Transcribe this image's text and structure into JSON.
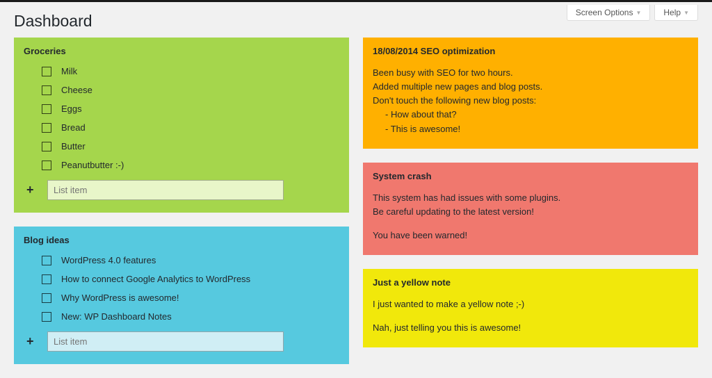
{
  "header": {
    "page_title": "Dashboard",
    "screen_options": "Screen Options",
    "help": "Help"
  },
  "notes": {
    "groceries": {
      "title": "Groceries",
      "items": [
        "Milk",
        "Cheese",
        "Eggs",
        "Bread",
        "Butter",
        "Peanutbutter :-)"
      ],
      "add_placeholder": "List item"
    },
    "blog_ideas": {
      "title": "Blog ideas",
      "items": [
        "WordPress 4.0 features",
        "How to connect Google Analytics to WordPress",
        "Why WordPress is awesome!",
        "New: WP Dashboard Notes"
      ],
      "add_placeholder": "List item"
    },
    "seo": {
      "title": "18/08/2014 SEO optimization",
      "lines": [
        "Been busy with SEO for two hours.",
        "Added multiple new pages and blog posts.",
        "Don't touch the following new blog posts:"
      ],
      "sub": [
        "- How about that?",
        "- This is awesome!"
      ]
    },
    "crash": {
      "title": "System crash",
      "lines": [
        "This system has had issues with some plugins.",
        "Be careful updating to the latest version!"
      ],
      "footer": "You have been warned!"
    },
    "yellow": {
      "title": "Just a yellow note",
      "lines": [
        "I just wanted to make a yellow note ;-)"
      ],
      "footer": "Nah, just telling you this is awesome!"
    }
  }
}
